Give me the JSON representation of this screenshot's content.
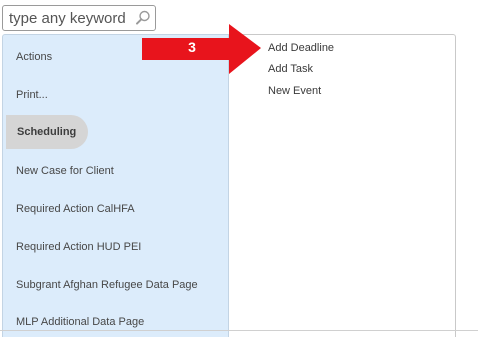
{
  "search": {
    "placeholder": "type any keyword"
  },
  "menu": {
    "items": [
      {
        "label": "Actions"
      },
      {
        "label": "Print..."
      },
      {
        "label": "Scheduling"
      },
      {
        "label": "New Case for Client"
      },
      {
        "label": "Required Action CalHFA"
      },
      {
        "label": "Required Action HUD PEI"
      },
      {
        "label": "Subgrant Afghan Refugee Data Page"
      },
      {
        "label": "MLP Additional Data Page"
      }
    ]
  },
  "submenu": {
    "items": [
      {
        "label": "Add Deadline"
      },
      {
        "label": "Add Task"
      },
      {
        "label": "New Event"
      }
    ]
  },
  "callout": {
    "label": "3",
    "color": "#e8141c"
  },
  "colors": {
    "menu_background": "#dcecfb",
    "selected_pill": "#d5d5d5"
  }
}
